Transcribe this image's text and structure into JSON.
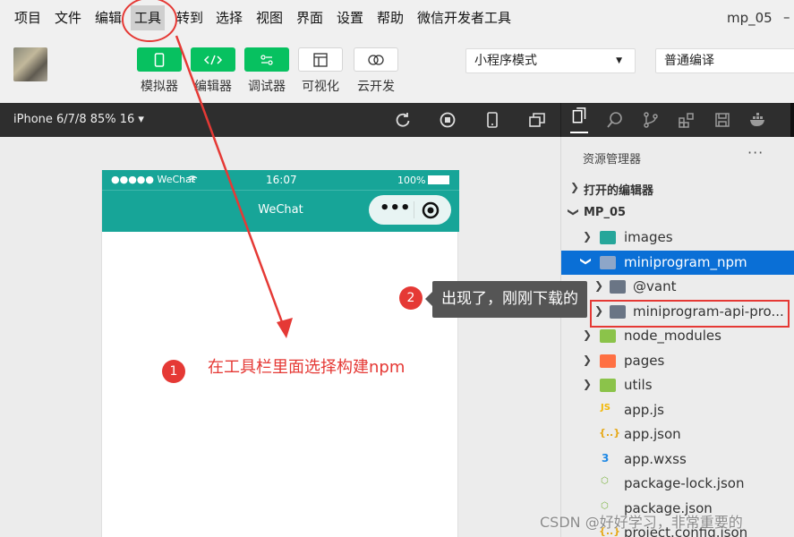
{
  "menubar": {
    "items": [
      "项目",
      "文件",
      "编辑",
      "工具",
      "转到",
      "选择",
      "视图",
      "界面",
      "设置",
      "帮助",
      "微信开发者工具"
    ],
    "window_title": "mp_05",
    "minimize": "–"
  },
  "toolbar": {
    "tools": [
      {
        "label": "模拟器",
        "icon": "phone-icon"
      },
      {
        "label": "编辑器",
        "icon": "code-icon"
      },
      {
        "label": "调试器",
        "icon": "debug-toggle-icon"
      },
      {
        "label": "可视化",
        "icon": "layout-icon"
      },
      {
        "label": "云开发",
        "icon": "cloud-icon"
      }
    ],
    "mode_select": "小程序模式",
    "compile_select": "普通编译"
  },
  "simulator": {
    "device": "iPhone 6/7/8 85% 16 ▾",
    "status_left": "●●●●● WeChat",
    "status_time": "16:07",
    "status_battery": "100%",
    "nav_title": "WeChat",
    "capsule_dots": "•••"
  },
  "explorer": {
    "title": "资源管理器",
    "more": "···",
    "open_editors": "打开的编辑器",
    "project": "MP_05",
    "tree": [
      {
        "label": "images",
        "type": "folder"
      },
      {
        "label": "miniprogram_npm",
        "type": "folder-open"
      },
      {
        "label": "@vant",
        "type": "folder"
      },
      {
        "label": "miniprogram-api-pro...",
        "type": "folder"
      },
      {
        "label": "node_modules",
        "type": "folder"
      },
      {
        "label": "pages",
        "type": "folder"
      },
      {
        "label": "utils",
        "type": "folder"
      },
      {
        "label": "app.js",
        "type": "js"
      },
      {
        "label": "app.json",
        "type": "json"
      },
      {
        "label": "app.wxss",
        "type": "css"
      },
      {
        "label": "package-lock.json",
        "type": "node"
      },
      {
        "label": "package.json",
        "type": "node"
      },
      {
        "label": "project.config.json",
        "type": "json"
      }
    ]
  },
  "annotations": {
    "step1_number": "1",
    "step1_text": "在工具栏里面选择构建npm",
    "step2_number": "2",
    "step2_text": "出现了，刚刚下载的",
    "watermark": "CSDN @好好学习，非常重要的"
  },
  "colors": {
    "wechat_green": "#07c160",
    "nav_teal": "#17a598",
    "selection_blue": "#0a6fd6",
    "annotation_red": "#e53935"
  }
}
